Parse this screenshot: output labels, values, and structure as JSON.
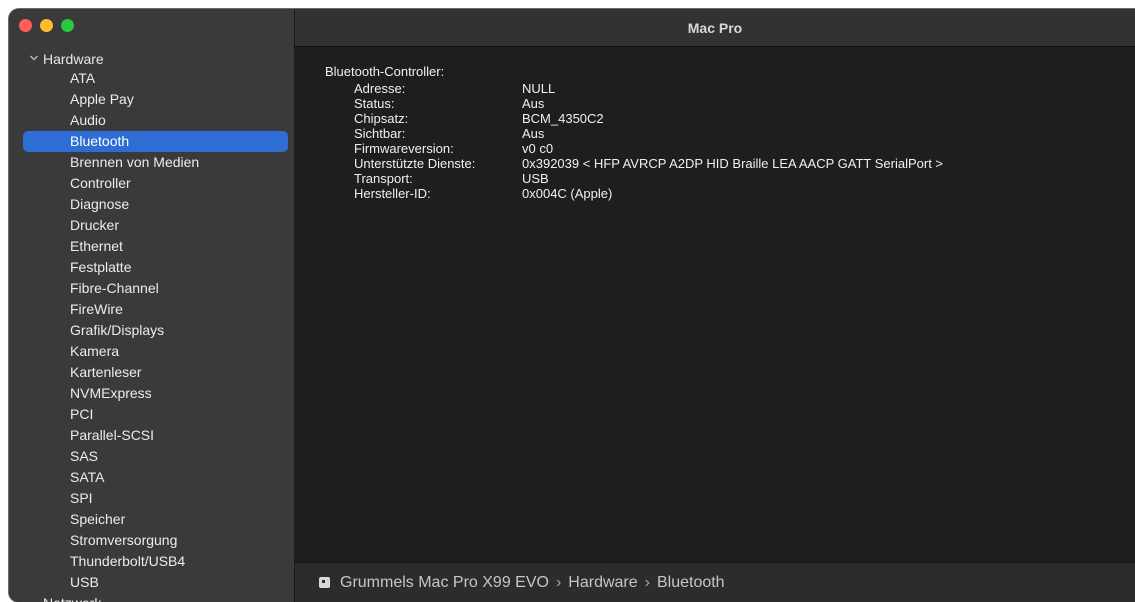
{
  "window": {
    "title": "Mac Pro",
    "traffic_lights": [
      {
        "name": "close",
        "color": "#ff5f57"
      },
      {
        "name": "minimize",
        "color": "#febc2e"
      },
      {
        "name": "zoom",
        "color": "#28c840"
      }
    ]
  },
  "sidebar": {
    "group_label": "Hardware",
    "group_expanded": true,
    "items": [
      {
        "label": "ATA"
      },
      {
        "label": "Apple Pay"
      },
      {
        "label": "Audio"
      },
      {
        "label": "Bluetooth",
        "selected": true
      },
      {
        "label": "Brennen von Medien"
      },
      {
        "label": "Controller"
      },
      {
        "label": "Diagnose"
      },
      {
        "label": "Drucker"
      },
      {
        "label": "Ethernet"
      },
      {
        "label": "Festplatte"
      },
      {
        "label": "Fibre-Channel"
      },
      {
        "label": "FireWire"
      },
      {
        "label": "Grafik/Displays"
      },
      {
        "label": "Kamera"
      },
      {
        "label": "Kartenleser"
      },
      {
        "label": "NVMExpress"
      },
      {
        "label": "PCI"
      },
      {
        "label": "Parallel-SCSI"
      },
      {
        "label": "SAS"
      },
      {
        "label": "SATA"
      },
      {
        "label": "SPI"
      },
      {
        "label": "Speicher"
      },
      {
        "label": "Stromversorgung"
      },
      {
        "label": "Thunderbolt/USB4"
      },
      {
        "label": "USB"
      }
    ],
    "next_group_label": "Netzwerk",
    "selection_color": "#2e6dd4"
  },
  "content": {
    "section_title": "Bluetooth-Controller:",
    "properties": [
      {
        "label": "Adresse:",
        "value": "NULL"
      },
      {
        "label": "Status:",
        "value": "Aus"
      },
      {
        "label": "Chipsatz:",
        "value": "BCM_4350C2"
      },
      {
        "label": "Sichtbar:",
        "value": "Aus"
      },
      {
        "label": "Firmwareversion:",
        "value": "v0 c0"
      },
      {
        "label": "Unterstützte Dienste:",
        "value": "0x392039 < HFP AVRCP A2DP HID Braille LEA AACP GATT SerialPort >"
      },
      {
        "label": "Transport:",
        "value": "USB"
      },
      {
        "label": "Hersteller-ID:",
        "value": "0x004C (Apple)"
      }
    ]
  },
  "statusbar": {
    "icon": "computer-icon",
    "breadcrumb": [
      "Grummels Mac Pro X99 EVO",
      "Hardware",
      "Bluetooth"
    ],
    "separator": "›"
  }
}
